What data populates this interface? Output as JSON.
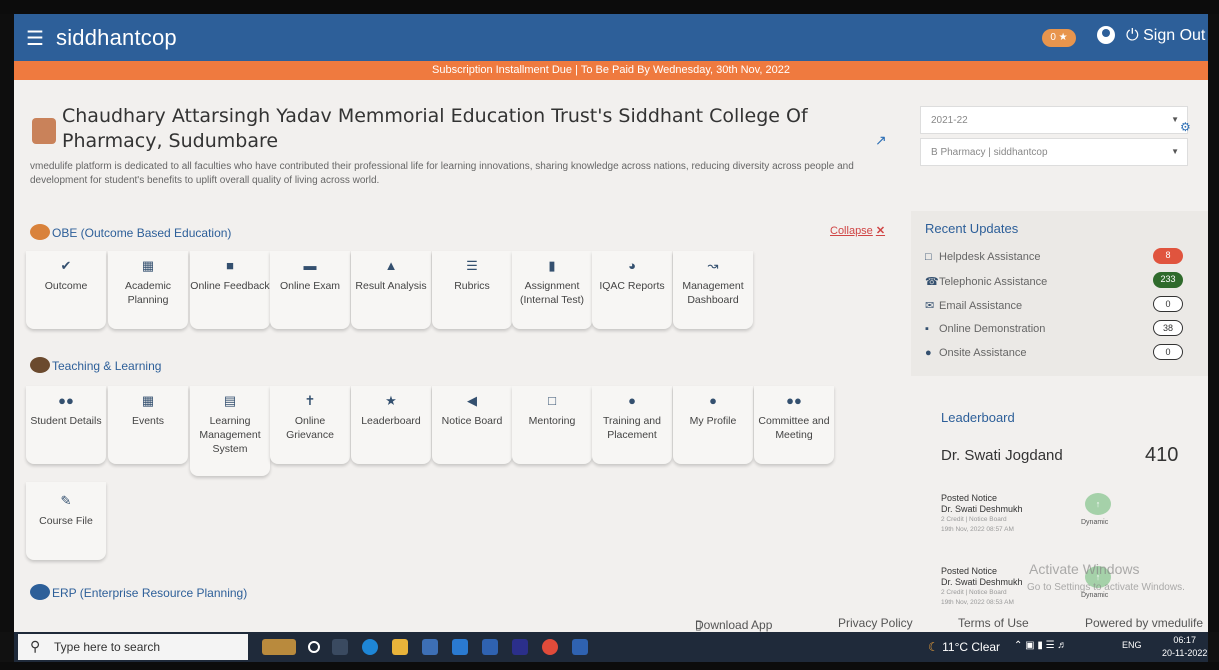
{
  "nav": {
    "brand": "siddhantcop",
    "trophy_count": "0",
    "signout_label": "Sign Out"
  },
  "banner": "Subscription Installment Due | To Be Paid By Wednesday, 30th Nov, 2022",
  "college": {
    "name": "Chaudhary Attarsingh Yadav Memmorial Education Trust's Siddhant College Of Pharmacy, Sudumbare",
    "tagline": "vmedulife platform is dedicated to all faculties who have contributed their professional life for learning innovations, sharing knowledge across nations, reducing diversity across people and development for student's benefits to uplift overall quality of living across world."
  },
  "selectors": {
    "year": "2021-22",
    "program": "B Pharmacy | siddhantcop"
  },
  "obe": {
    "title": "OBE (Outcome Based Education)",
    "collapse_label": "Collapse",
    "tiles": [
      {
        "label": "Outcome",
        "icon": "check-icon"
      },
      {
        "label": "Academic Planning",
        "icon": "calendar-icon"
      },
      {
        "label": "Online Feedback",
        "icon": "comment-icon"
      },
      {
        "label": "Online Exam",
        "icon": "folder-icon"
      },
      {
        "label": "Result Analysis",
        "icon": "area-chart-icon"
      },
      {
        "label": "Rubrics",
        "icon": "list-icon"
      },
      {
        "label": "Assignment (Internal Test)",
        "icon": "file-icon"
      },
      {
        "label": "IQAC Reports",
        "icon": "pie-chart-icon"
      },
      {
        "label": "Management Dashboard",
        "icon": "line-chart-icon"
      }
    ]
  },
  "teaching": {
    "title": "Teaching & Learning",
    "tiles": [
      {
        "label": "Student Details",
        "icon": "users-icon"
      },
      {
        "label": "Events",
        "icon": "calendar-check-icon"
      },
      {
        "label": "Learning Management System",
        "icon": "book-icon"
      },
      {
        "label": "Online Grievance",
        "icon": "person-icon"
      },
      {
        "label": "Leaderboard",
        "icon": "trophy-icon"
      },
      {
        "label": "Notice Board",
        "icon": "bullhorn-icon"
      },
      {
        "label": "Mentoring",
        "icon": "chat-icon"
      },
      {
        "label": "Training and Placement",
        "icon": "user-tie-icon"
      },
      {
        "label": "My Profile",
        "icon": "user-icon"
      },
      {
        "label": "Committee and Meeting",
        "icon": "group-icon"
      },
      {
        "label": "Course File",
        "icon": "file-edit-icon"
      }
    ]
  },
  "erp": {
    "title": "ERP (Enterprise Resource Planning)"
  },
  "recent_updates": {
    "title": "Recent Updates",
    "items": [
      {
        "label": "Helpdesk Assistance",
        "count": "8",
        "color": "#e0543e"
      },
      {
        "label": "Telephonic Assistance",
        "count": "233",
        "color": "#2f6a2c"
      },
      {
        "label": "Email Assistance",
        "count": "0",
        "color": "#ffffff"
      },
      {
        "label": "Online Demonstration",
        "count": "38",
        "color": "#ffffff"
      },
      {
        "label": "Onsite Assistance",
        "count": "0",
        "color": "#ffffff"
      }
    ]
  },
  "leaderboard": {
    "title": "Leaderboard",
    "leader": "Dr. Swati Jogdand",
    "score": "410",
    "posts": [
      {
        "action": "Posted Notice",
        "name": "Dr. Swati Deshmukh",
        "meta": "2 Credit | Notice Board",
        "time": "19th Nov, 2022 08:57 AM",
        "tag": "Dynamic"
      },
      {
        "action": "Posted Notice",
        "name": "Dr. Swati Deshmukh",
        "meta": "2 Credit | Notice Board",
        "time": "19th Nov, 2022 08:53 AM",
        "tag": "Dynamic"
      }
    ]
  },
  "watermark": {
    "line1": "Activate Windows",
    "line2": "Go to Settings to activate Windows."
  },
  "footer": {
    "download": "Download App",
    "privacy": "Privacy Policy",
    "terms": "Terms of Use",
    "powered": "Powered by vmedulife"
  },
  "taskbar": {
    "search_placeholder": "Type here to search",
    "weather": "11°C Clear",
    "lang": "ENG",
    "time": "06:17",
    "date": "20-11-2022"
  }
}
